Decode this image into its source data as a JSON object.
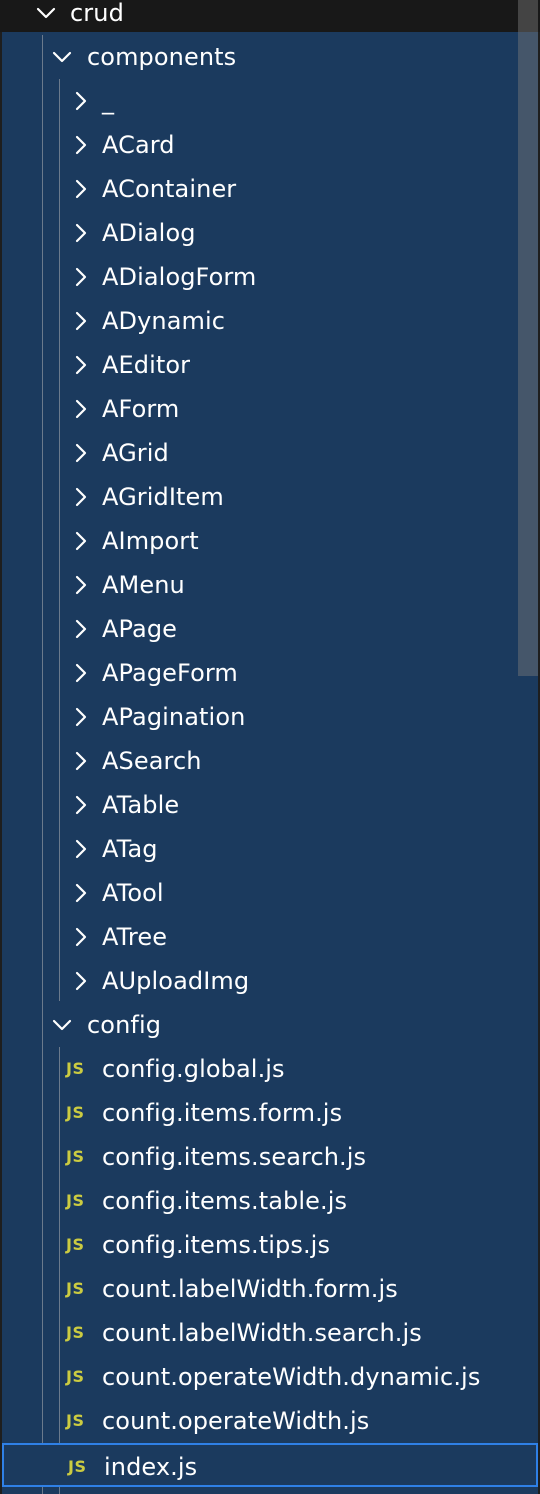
{
  "tree": {
    "root": {
      "label": "crud",
      "expanded": true
    },
    "components": {
      "label": "components",
      "expanded": true,
      "items": [
        "_",
        "ACard",
        "AContainer",
        "ADialog",
        "ADialogForm",
        "ADynamic",
        "AEditor",
        "AForm",
        "AGrid",
        "AGridItem",
        "AImport",
        "AMenu",
        "APage",
        "APageForm",
        "APagination",
        "ASearch",
        "ATable",
        "ATag",
        "ATool",
        "ATree",
        "AUploadImg"
      ]
    },
    "config": {
      "label": "config",
      "expanded": true,
      "files": [
        "config.global.js",
        "config.items.form.js",
        "config.items.search.js",
        "config.items.table.js",
        "config.items.tips.js",
        "count.labelWidth.form.js",
        "count.labelWidth.search.js",
        "count.operateWidth.dynamic.js",
        "count.operateWidth.js",
        "index.js"
      ],
      "selected_file": "index.js",
      "file_icon": "JS"
    }
  },
  "colors": {
    "panel": "#1b3a5e",
    "js_icon": "#cbcb41",
    "selection_border": "#2f80e6"
  }
}
